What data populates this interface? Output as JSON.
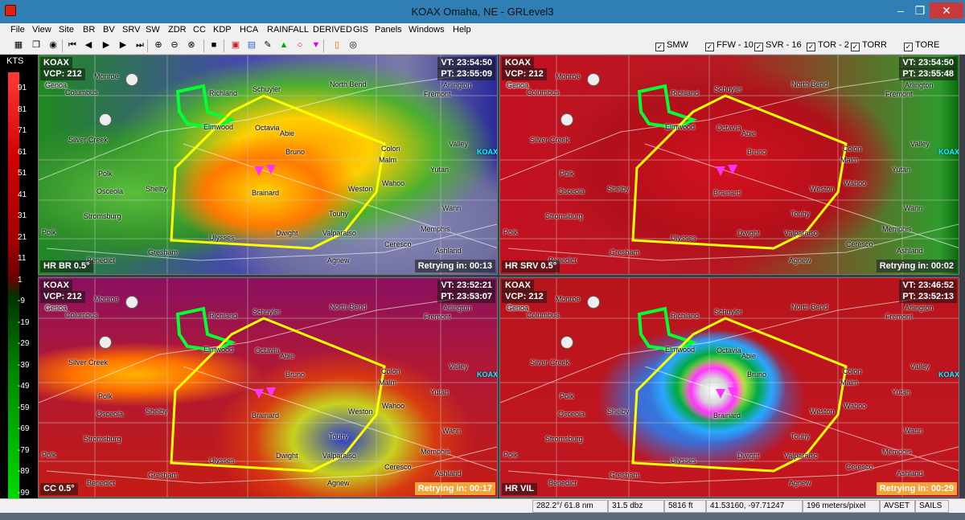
{
  "window": {
    "title": "KOAX Omaha, NE - GRLevel3",
    "min": "–",
    "max": "❐",
    "close": "✕"
  },
  "menu": [
    "File",
    "View",
    "Site",
    "BR",
    "BV",
    "SRV",
    "SW",
    "ZDR",
    "CC",
    "KDP",
    "HCA",
    "RAINFALL",
    "DERIVED",
    "GIS",
    "Panels",
    "Windows",
    "Help"
  ],
  "toolbar_icons": [
    "grid-icon",
    "copy-icon",
    "color-icon",
    "skip-first-icon",
    "step-back-icon",
    "play-icon",
    "step-forward-icon",
    "skip-last-icon",
    "zoom-in-icon",
    "zoom-out-icon",
    "zoom-reset-icon",
    "stop-icon",
    "palette-icon",
    "layers-icon",
    "pick-icon",
    "triangle-icon",
    "circle-icon",
    "down-triangle-icon",
    "marker-icon",
    "target-icon"
  ],
  "warnings": [
    {
      "label": "SMW",
      "checked": true
    },
    {
      "label": "FFW - 10",
      "checked": true
    },
    {
      "label": "SVR - 16",
      "checked": true
    },
    {
      "label": "TOR - 2",
      "checked": true
    },
    {
      "label": "TORR",
      "checked": true
    },
    {
      "label": "TORE",
      "checked": true
    }
  ],
  "legend": {
    "units": "KTS",
    "ticks": [
      "91",
      "81",
      "71",
      "61",
      "51",
      "41",
      "31",
      "21",
      "11",
      "1",
      "-9",
      "-19",
      "-29",
      "-39",
      "-49",
      "-59",
      "-69",
      "-79",
      "-89",
      "-99"
    ]
  },
  "panels": [
    {
      "site": "KOAX",
      "vcp": "VCP: 212",
      "vt": "VT: 23:54:50",
      "pt": "PT: 23:55:09",
      "product": "HR BR 0.5°",
      "retry": "Retrying in: 00:13",
      "retry_warn": false
    },
    {
      "site": "KOAX",
      "vcp": "VCP: 212",
      "vt": "VT: 23:54:50",
      "pt": "PT: 23:55:48",
      "product": "HR SRV 0.5°",
      "retry": "Retrying in: 00:02",
      "retry_warn": false
    },
    {
      "site": "KOAX",
      "vcp": "VCP: 212",
      "vt": "VT: 23:52:21",
      "pt": "PT: 23:53:07",
      "product": "CC 0.5°",
      "retry": "Retrying in: 00:17",
      "retry_warn": true
    },
    {
      "site": "KOAX",
      "vcp": "VCP: 212",
      "vt": "VT: 23:46:52",
      "pt": "PT: 23:52:13",
      "product": "HR VIL",
      "retry": "Retrying in: 00:29",
      "retry_warn": true
    }
  ],
  "towns": [
    "Monroe",
    "Genoa",
    "Columbus",
    "Richland",
    "Schuyler",
    "North Bend",
    "Arlington",
    "Fremont",
    "Octavia",
    "Abie",
    "Silver Creek",
    "Bruno",
    "Colon",
    "Valley",
    "Malm",
    "Polk",
    "Osceola",
    "Shelby",
    "Brainard",
    "Weston",
    "Wahoo",
    "Yutan",
    "Stromsburg",
    "Touhy",
    "Wann",
    "Ulysses",
    "Dwight",
    "Valparaiso",
    "Memphis",
    "Ceresco",
    "Ashland",
    "Gresham",
    "Agnew",
    "Benedict",
    "Polk",
    "Genoa"
  ],
  "town_extra": {
    "elmwood": "Elmwood",
    "koax": "KOAX"
  },
  "status": {
    "bearing": "282.2°/ 61.8 nm",
    "value": "31.5 dbz",
    "height": "5816 ft",
    "coords": "41.53160, -97.71247",
    "resolution": "196 meters/pixel",
    "avset": "AVSET",
    "sails": "SAILS"
  },
  "colors": {
    "titlebar": "#2f7fb4",
    "close": "#c7393a",
    "warning_polygon": "#ffff00",
    "watch_polygon": "#00ff33",
    "retry_warn": "#f2a33a"
  }
}
